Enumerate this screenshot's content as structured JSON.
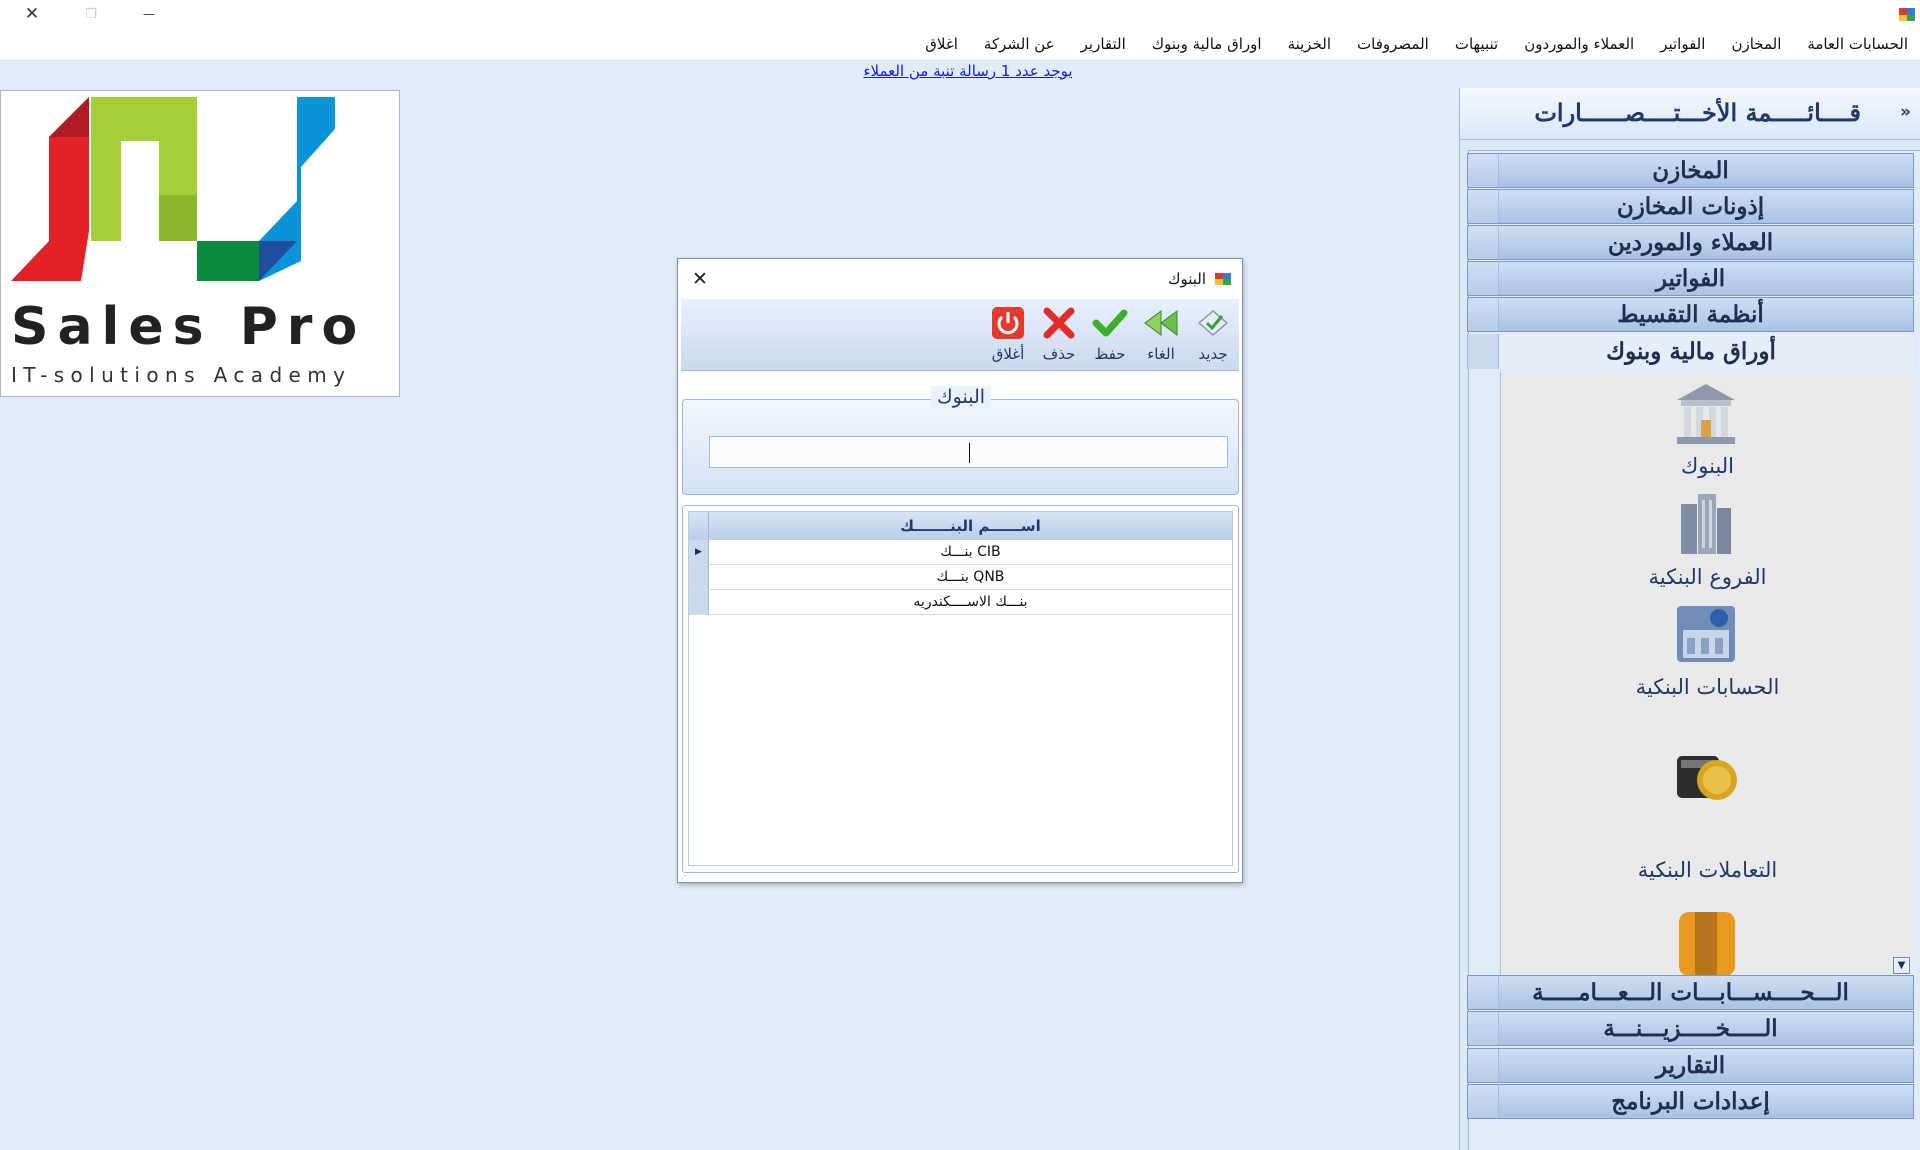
{
  "window": {
    "close_glyph": "✕",
    "maximize_glyph": "❐",
    "minimize_glyph": "—"
  },
  "menu": {
    "items": [
      "الحسابات العامة",
      "المخازن",
      "الفواتير",
      "العملاء والموردون",
      "تنبيهات",
      "المصروفات",
      "الخزينة",
      "اوراق مالية وبنوك",
      "التقارير",
      "عن الشركة",
      "اغلاق"
    ]
  },
  "notice": "يوجد عدد 1 رسالة تنبة من العملاء",
  "logo": {
    "brand": "Sales Pro",
    "tagline": "IT-solutions Academy",
    "colors": [
      "#e32128",
      "#a6ce39",
      "#0a8a3e",
      "#0a94d8",
      "#1f4f9c"
    ]
  },
  "sidebar": {
    "title": "قــــائـــــمة الأخـــتــــصــــــارات",
    "collapse_glyph": "»",
    "groups_top": [
      "المخازن",
      "إذونات المخازن",
      "العملاء والموردين",
      "الفواتير",
      "أنظمة التقسيط"
    ],
    "open_group": "أوراق مالية وبنوك",
    "shortcuts": [
      "البنوك",
      "الفروع البنكية",
      "الحسابات البنكية",
      "التعاملات البنكية"
    ],
    "groups_bottom": [
      "الـــحــــســـابـــات الـــعـــامـــــة",
      "الـــــخـــــزيـــنـــة",
      "التقارير",
      "إعدادات البرنامج"
    ],
    "scroll_glyph": "▼"
  },
  "dialog": {
    "title": "البنوك",
    "close_glyph": "✕",
    "toolbar": [
      {
        "label": "جديد",
        "icon": "new-icon"
      },
      {
        "label": "الغاء",
        "icon": "undo-icon"
      },
      {
        "label": "حفظ",
        "icon": "save-icon"
      },
      {
        "label": "حذف",
        "icon": "delete-icon"
      },
      {
        "label": "أغلاق",
        "icon": "power-icon"
      }
    ],
    "group_title": "البنوك",
    "input_value": "",
    "grid": {
      "header": "اســــــم البنـــــــك",
      "rows": [
        "بنـــك CIB",
        "بنـــك QNB",
        "بنـــك الاســــكندريه"
      ],
      "selected_marker": "▶"
    }
  }
}
